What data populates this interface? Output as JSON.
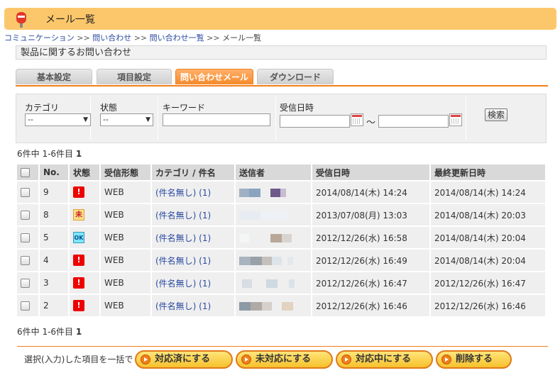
{
  "header": {
    "title": "メール一覧"
  },
  "breadcrumb": [
    {
      "label": "コミュニケーション"
    },
    {
      "label": "問い合わせ"
    },
    {
      "label": "問い合わせ一覧"
    },
    {
      "label": "メール一覧"
    }
  ],
  "breadcrumb_sep": ">>",
  "subject": "製品に関するお問い合わせ",
  "tabs": [
    {
      "label": "基本設定"
    },
    {
      "label": "項目設定"
    },
    {
      "label": "問い合わせメール",
      "active": true
    },
    {
      "label": "ダウンロード"
    }
  ],
  "filter": {
    "category_label": "カテゴリ",
    "category_value": "--",
    "status_label": "状態",
    "status_value": "--",
    "keyword_label": "キーワード",
    "keyword_value": "",
    "date_label": "受信日時",
    "date_from": "",
    "date_to": "",
    "tilde": "～",
    "search_button": "検索"
  },
  "pager": {
    "summary": "6件中 1-6件目",
    "page": "1"
  },
  "table": {
    "headers": [
      "",
      "No.",
      "状態",
      "受信形態",
      "カテゴリ / 件名",
      "送信者",
      "受信日時",
      "最終更新日時"
    ],
    "rows": [
      {
        "no": "9",
        "status": "new",
        "type": "WEB",
        "subject": "(件名無し) (1)",
        "received": "2014/08/14(木) 14:24",
        "updated": "2014/08/14(木) 14:24"
      },
      {
        "no": "8",
        "status": "in-progress",
        "type": "WEB",
        "subject": "(件名無し) (1)",
        "received": "2013/07/08(月) 13:03",
        "updated": "2014/08/14(木) 20:03"
      },
      {
        "no": "5",
        "status": "done",
        "type": "WEB",
        "subject": "(件名無し) (1)",
        "received": "2012/12/26(水) 16:58",
        "updated": "2014/08/14(木) 20:04"
      },
      {
        "no": "4",
        "status": "new",
        "type": "WEB",
        "subject": "(件名無し) (1)",
        "received": "2012/12/26(水) 16:49",
        "updated": "2014/08/14(木) 20:04"
      },
      {
        "no": "3",
        "status": "new",
        "type": "WEB",
        "subject": "(件名無し) (1)",
        "received": "2012/12/26(水) 16:47",
        "updated": "2012/12/26(水) 16:47"
      },
      {
        "no": "2",
        "status": "new",
        "type": "WEB",
        "subject": "(件名無し) (1)",
        "received": "2012/12/26(水) 16:46",
        "updated": "2012/12/26(水) 16:46"
      }
    ]
  },
  "status_icons": {
    "new": "!",
    "in-progress": "未",
    "done": "OK"
  },
  "actions": {
    "label": "選択(入力)した項目を一括で",
    "buttons": [
      {
        "label": "対応済にする"
      },
      {
        "label": "未対応にする"
      },
      {
        "label": "対応中にする"
      },
      {
        "label": "削除する"
      }
    ]
  },
  "colors": {
    "accent": "#f27f1a",
    "header_bg": "#fcc76a",
    "link": "#2a4aa0",
    "button": "#f6c12c"
  }
}
